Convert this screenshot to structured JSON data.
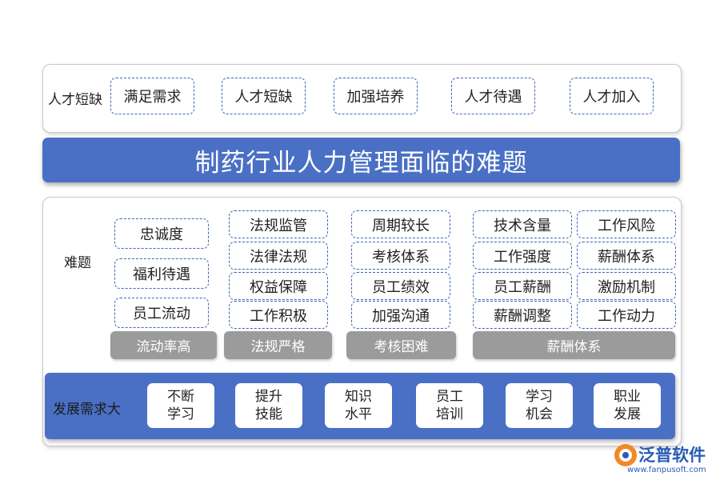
{
  "top": {
    "label": "人才短缺",
    "items": [
      "满足需求",
      "人才短缺",
      "加强培养",
      "人才待遇",
      "人才加入"
    ]
  },
  "title": "制药行业人力管理面临的难题",
  "middle": {
    "label": "难题",
    "groups": [
      {
        "footer": "流动率高",
        "items": [
          "忠诚度",
          "福利待遇",
          "员工流动"
        ]
      },
      {
        "footer": "法规严格",
        "items": [
          "法规监管",
          "法律法规",
          "权益保障",
          "工作积极"
        ]
      },
      {
        "footer": "考核困难",
        "items": [
          "周期较长",
          "考核体系",
          "员工绩效",
          "加强沟通"
        ]
      },
      {
        "footer": "薪酬体系",
        "items": [
          "技术含量",
          "工作风险",
          "工作强度",
          "薪酬体系",
          "员工薪酬",
          "激励机制",
          "薪酬调整",
          "工作动力"
        ]
      }
    ]
  },
  "bottom": {
    "label": "发展需求大",
    "items": [
      [
        "不断",
        "学习"
      ],
      [
        "提升",
        "技能"
      ],
      [
        "知识",
        "水平"
      ],
      [
        "员工",
        "培训"
      ],
      [
        "学习",
        "机会"
      ],
      [
        "职业",
        "发展"
      ]
    ]
  },
  "logo": {
    "name": "泛普软件",
    "url": "www.fanpusoft.com"
  },
  "colors": {
    "accent": "#4a70c5",
    "gray": "#9b9b9b",
    "dash": "#3f63b8",
    "logo_orange": "#f08a24"
  }
}
